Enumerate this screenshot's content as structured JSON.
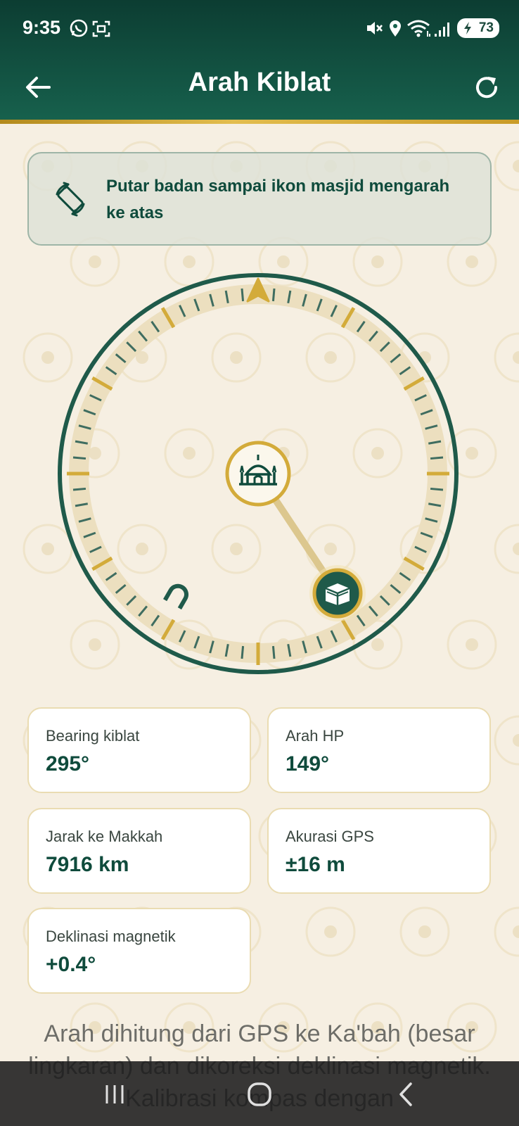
{
  "status_bar": {
    "time": "9:35",
    "battery": "73",
    "icons": [
      "whatsapp-icon",
      "screenshot-icon",
      "mute-icon",
      "location-icon",
      "wifi-icon",
      "signal-icon",
      "battery-icon"
    ]
  },
  "app_bar": {
    "title": "Arah Kiblat",
    "back_icon": "arrow-left-icon",
    "refresh_icon": "refresh-icon"
  },
  "hint": {
    "icon": "rotate-device-icon",
    "text": "Putar badan sampai ikon masjid mengarah ke atas"
  },
  "compass": {
    "heading_deg": 149,
    "qibla_bearing_deg": 295,
    "center_icon": "mosque-icon",
    "qibla_icon": "kaaba-icon",
    "north_marker_icon": "magnet-icon",
    "colors": {
      "ring": "#1f5a4a",
      "band": "#ecdfbf",
      "gold": "#d3ab3a",
      "minor_tick": "#3f6d60"
    }
  },
  "stats": [
    {
      "label": "Bearing kiblat",
      "value": "295°"
    },
    {
      "label": "Arah HP",
      "value": "149°"
    },
    {
      "label": "Jarak ke Makkah",
      "value": "7916 km"
    },
    {
      "label": "Akurasi GPS",
      "value": "±16 m"
    },
    {
      "label": "Deklinasi magnetik",
      "value": "+0.4°"
    }
  ],
  "footnote": "Arah dihitung dari GPS ke Ka'bah (besar lingkaran) dan dikoreksi deklinasi magnetik. Kalibrasi kompas dengan",
  "nav_bar": {
    "icons": [
      "recent-apps-icon",
      "home-icon",
      "back-icon"
    ]
  },
  "colors": {
    "primary": "#0f4b3c",
    "header": "#17614d",
    "accent_gold": "#d3ab3a",
    "background": "#f6efe2"
  }
}
